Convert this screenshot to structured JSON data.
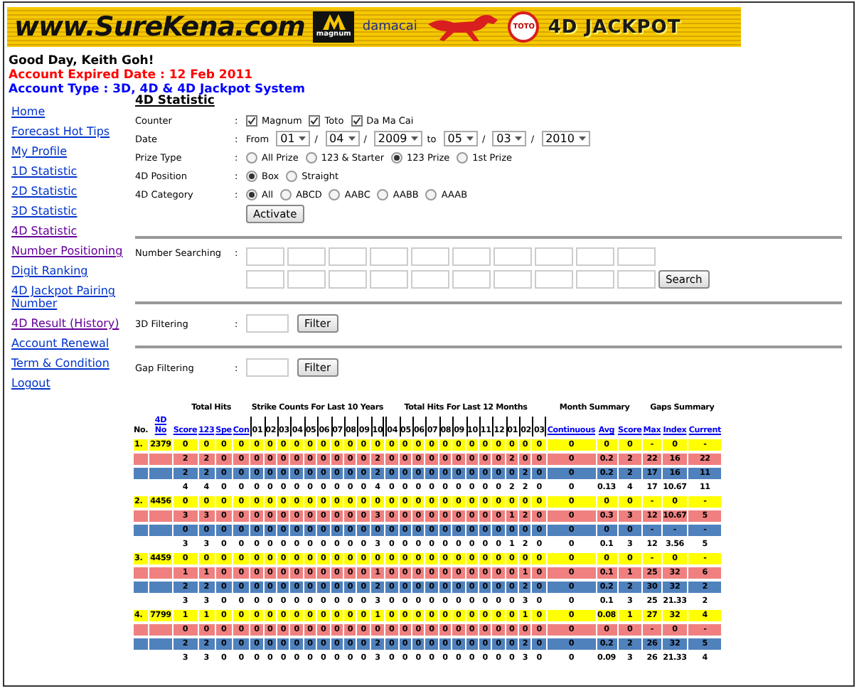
{
  "banner": {
    "site": "www.SureKena.com",
    "logos": [
      {
        "kind": "magnum",
        "text": "magnum"
      },
      {
        "kind": "damacai",
        "text": "damacai"
      },
      {
        "kind": "horse"
      },
      {
        "kind": "toto",
        "text": "TOTO"
      },
      {
        "kind": "jackpot",
        "text": "4D JACKPOT"
      }
    ]
  },
  "greeting": "Good Day, Keith Goh!",
  "expiry": "Account Expired Date : 12 Feb 2011",
  "account_type": "Account Type : 3D, 4D & 4D Jackpot System",
  "sidebar": {
    "items": [
      {
        "label": "Home",
        "visited": false
      },
      {
        "label": "Forecast Hot Tips",
        "visited": false
      },
      {
        "label": "My Profile",
        "visited": false
      },
      {
        "label": "1D Statistic",
        "visited": false
      },
      {
        "label": "2D Statistic",
        "visited": false
      },
      {
        "label": "3D Statistic",
        "visited": false
      },
      {
        "label": "4D Statistic",
        "visited": true
      },
      {
        "label": "Number Positioning",
        "visited": true
      },
      {
        "label": "Digit Ranking",
        "visited": false
      },
      {
        "label": "4D Jackpot Pairing Number",
        "visited": false
      },
      {
        "label": "4D Result (History)",
        "visited": true
      },
      {
        "label": "Account Renewal",
        "visited": false
      },
      {
        "label": "Term & Condition",
        "visited": false
      },
      {
        "label": "Logout",
        "visited": false
      }
    ]
  },
  "form": {
    "title": "4D Statistic",
    "rows": [
      {
        "kind": "checks",
        "label": "Counter",
        "colon": ":",
        "options": [
          {
            "label": "Magnum",
            "checked": true
          },
          {
            "label": "Toto",
            "checked": true
          },
          {
            "label": "Da Ma Cai",
            "checked": true
          }
        ]
      },
      {
        "kind": "date",
        "label": "Date",
        "colon": ":",
        "parts": [
          {
            "kind": "text",
            "value": "From"
          },
          {
            "kind": "select",
            "value": "01"
          },
          {
            "kind": "text",
            "value": "/"
          },
          {
            "kind": "select",
            "value": "04"
          },
          {
            "kind": "text",
            "value": "/"
          },
          {
            "kind": "select",
            "value": "2009"
          },
          {
            "kind": "text",
            "value": "to"
          },
          {
            "kind": "select",
            "value": "05"
          },
          {
            "kind": "text",
            "value": "/"
          },
          {
            "kind": "select",
            "value": "03"
          },
          {
            "kind": "text",
            "value": "/"
          },
          {
            "kind": "select",
            "value": "2010"
          }
        ]
      },
      {
        "kind": "radios",
        "label": "Prize Type",
        "colon": ":",
        "options": [
          {
            "label": "All Prize",
            "selected": false
          },
          {
            "label": "123 & Starter",
            "selected": false
          },
          {
            "label": "123 Prize",
            "selected": true
          },
          {
            "label": "1st Prize",
            "selected": false
          }
        ]
      },
      {
        "kind": "radios",
        "label": "4D Position",
        "colon": ":",
        "options": [
          {
            "label": "Box",
            "selected": true
          },
          {
            "label": "Straight",
            "selected": false
          }
        ]
      },
      {
        "kind": "radios",
        "label": "4D Category",
        "colon": ":",
        "options": [
          {
            "label": "All",
            "selected": true
          },
          {
            "label": "ABCD",
            "selected": false
          },
          {
            "label": "AABC",
            "selected": false
          },
          {
            "label": "AABB",
            "selected": false
          },
          {
            "label": "AAAB",
            "selected": false
          }
        ]
      }
    ],
    "activate": "Activate"
  },
  "searching": {
    "label": "Number Searching",
    "colon": ":",
    "button": "Search"
  },
  "filters": [
    {
      "label": "3D Filtering",
      "colon": ":",
      "button": "Filter"
    },
    {
      "label": "Gap Filtering",
      "colon": ":",
      "button": "Filter"
    }
  ],
  "table": {
    "sections": [
      {
        "link": false,
        "columns": [
          "No."
        ]
      },
      {
        "link": true,
        "columns": [
          "4D No"
        ]
      },
      {
        "title": "Total Hits",
        "link": true,
        "columns": [
          "Score",
          "123",
          "Spe",
          "Con"
        ]
      },
      {
        "title": "Strike Counts For Last 10 Years",
        "link": false,
        "columns": [
          "01",
          "02",
          "03",
          "04",
          "05",
          "06",
          "07",
          "08",
          "09",
          "10"
        ]
      },
      {
        "title": "Total Hits For Last 12 Months",
        "link": false,
        "columns": [
          "04",
          "05",
          "06",
          "07",
          "08",
          "09",
          "10",
          "11",
          "12",
          "01",
          "02",
          "03"
        ]
      },
      {
        "title": "Month Summary",
        "link": true,
        "columns": [
          "Continuous",
          "Avg",
          "Score"
        ]
      },
      {
        "title": "Gaps Summary",
        "link": true,
        "columns": [
          "Max",
          "Index",
          "Current"
        ]
      }
    ],
    "rows": [
      {
        "color": "#ffff00",
        "no": "1.",
        "number": "2379",
        "cells": [
          "0",
          "0",
          "0",
          "0",
          "0",
          "0",
          "0",
          "0",
          "0",
          "0",
          "0",
          "0",
          "0",
          "0",
          "0",
          "0",
          "0",
          "0",
          "0",
          "0",
          "0",
          "0",
          "0",
          "0",
          "0",
          "0",
          "0",
          "0",
          "0",
          "-",
          "0",
          "-"
        ]
      },
      {
        "color": "#f08080",
        "cells": [
          "2",
          "2",
          "0",
          "0",
          "0",
          "0",
          "0",
          "0",
          "0",
          "0",
          "0",
          "0",
          "0",
          "2",
          "0",
          "0",
          "0",
          "0",
          "0",
          "0",
          "0",
          "0",
          "0",
          "2",
          "0",
          "0",
          "0",
          "0.2",
          "2",
          "22",
          "16",
          "22"
        ]
      },
      {
        "color": "#4f81bd",
        "cells": [
          "2",
          "2",
          "0",
          "0",
          "0",
          "0",
          "0",
          "0",
          "0",
          "0",
          "0",
          "0",
          "0",
          "2",
          "0",
          "0",
          "0",
          "0",
          "0",
          "0",
          "0",
          "0",
          "0",
          "0",
          "2",
          "0",
          "0",
          "0.2",
          "2",
          "17",
          "16",
          "11"
        ]
      },
      {
        "color": "#ffffff",
        "cells": [
          "4",
          "4",
          "0",
          "0",
          "0",
          "0",
          "0",
          "0",
          "0",
          "0",
          "0",
          "0",
          "0",
          "4",
          "0",
          "0",
          "0",
          "0",
          "0",
          "0",
          "0",
          "0",
          "0",
          "2",
          "2",
          "0",
          "0",
          "0.13",
          "4",
          "17",
          "10.67",
          "11"
        ]
      },
      {
        "color": "#ffff00",
        "no": "2.",
        "number": "4456",
        "cells": [
          "0",
          "0",
          "0",
          "0",
          "0",
          "0",
          "0",
          "0",
          "0",
          "0",
          "0",
          "0",
          "0",
          "0",
          "0",
          "0",
          "0",
          "0",
          "0",
          "0",
          "0",
          "0",
          "0",
          "0",
          "0",
          "0",
          "0",
          "0",
          "0",
          "-",
          "0",
          "-"
        ]
      },
      {
        "color": "#f08080",
        "cells": [
          "3",
          "3",
          "0",
          "0",
          "0",
          "0",
          "0",
          "0",
          "0",
          "0",
          "0",
          "0",
          "0",
          "3",
          "0",
          "0",
          "0",
          "0",
          "0",
          "0",
          "0",
          "0",
          "0",
          "1",
          "2",
          "0",
          "0",
          "0.3",
          "3",
          "12",
          "10.67",
          "5"
        ]
      },
      {
        "color": "#4f81bd",
        "cells": [
          "0",
          "0",
          "0",
          "0",
          "0",
          "0",
          "0",
          "0",
          "0",
          "0",
          "0",
          "0",
          "0",
          "0",
          "0",
          "0",
          "0",
          "0",
          "0",
          "0",
          "0",
          "0",
          "0",
          "0",
          "0",
          "0",
          "0",
          "0",
          "0",
          "-",
          "-",
          "-"
        ]
      },
      {
        "color": "#ffffff",
        "cells": [
          "3",
          "3",
          "0",
          "0",
          "0",
          "0",
          "0",
          "0",
          "0",
          "0",
          "0",
          "0",
          "0",
          "3",
          "0",
          "0",
          "0",
          "0",
          "0",
          "0",
          "0",
          "0",
          "0",
          "1",
          "2",
          "0",
          "0",
          "0.1",
          "3",
          "12",
          "3.56",
          "5"
        ]
      },
      {
        "color": "#ffff00",
        "no": "3.",
        "number": "4459",
        "cells": [
          "0",
          "0",
          "0",
          "0",
          "0",
          "0",
          "0",
          "0",
          "0",
          "0",
          "0",
          "0",
          "0",
          "0",
          "0",
          "0",
          "0",
          "0",
          "0",
          "0",
          "0",
          "0",
          "0",
          "0",
          "0",
          "0",
          "0",
          "0",
          "0",
          "-",
          "0",
          "-"
        ]
      },
      {
        "color": "#f08080",
        "cells": [
          "1",
          "1",
          "0",
          "0",
          "0",
          "0",
          "0",
          "0",
          "0",
          "0",
          "0",
          "0",
          "0",
          "1",
          "0",
          "0",
          "0",
          "0",
          "0",
          "0",
          "0",
          "0",
          "0",
          "0",
          "1",
          "0",
          "0",
          "0.1",
          "1",
          "25",
          "32",
          "6"
        ]
      },
      {
        "color": "#4f81bd",
        "cells": [
          "2",
          "2",
          "0",
          "0",
          "0",
          "0",
          "0",
          "0",
          "0",
          "0",
          "0",
          "0",
          "0",
          "2",
          "0",
          "0",
          "0",
          "0",
          "0",
          "0",
          "0",
          "0",
          "0",
          "0",
          "2",
          "0",
          "0",
          "0.2",
          "2",
          "30",
          "32",
          "2"
        ]
      },
      {
        "color": "#ffffff",
        "cells": [
          "3",
          "3",
          "0",
          "0",
          "0",
          "0",
          "0",
          "0",
          "0",
          "0",
          "0",
          "0",
          "0",
          "3",
          "0",
          "0",
          "0",
          "0",
          "0",
          "0",
          "0",
          "0",
          "0",
          "0",
          "3",
          "0",
          "0",
          "0.1",
          "3",
          "25",
          "21.33",
          "2"
        ]
      },
      {
        "color": "#ffff00",
        "no": "4.",
        "number": "7799",
        "cells": [
          "1",
          "1",
          "0",
          "0",
          "0",
          "0",
          "0",
          "0",
          "0",
          "0",
          "0",
          "0",
          "0",
          "1",
          "0",
          "0",
          "0",
          "0",
          "0",
          "0",
          "0",
          "0",
          "0",
          "0",
          "1",
          "0",
          "0",
          "0.08",
          "1",
          "27",
          "32",
          "4"
        ]
      },
      {
        "color": "#f08080",
        "cells": [
          "0",
          "0",
          "0",
          "0",
          "0",
          "0",
          "0",
          "0",
          "0",
          "0",
          "0",
          "0",
          "0",
          "0",
          "0",
          "0",
          "0",
          "0",
          "0",
          "0",
          "0",
          "0",
          "0",
          "0",
          "0",
          "0",
          "0",
          "0",
          "0",
          "-",
          "0",
          "-"
        ]
      },
      {
        "color": "#4f81bd",
        "cells": [
          "2",
          "2",
          "0",
          "0",
          "0",
          "0",
          "0",
          "0",
          "0",
          "0",
          "0",
          "0",
          "0",
          "2",
          "0",
          "0",
          "0",
          "0",
          "0",
          "0",
          "0",
          "0",
          "0",
          "0",
          "2",
          "0",
          "0",
          "0.2",
          "2",
          "26",
          "32",
          "5"
        ]
      },
      {
        "color": "#ffffff",
        "cells": [
          "3",
          "3",
          "0",
          "0",
          "0",
          "0",
          "0",
          "0",
          "0",
          "0",
          "0",
          "0",
          "0",
          "3",
          "0",
          "0",
          "0",
          "0",
          "0",
          "0",
          "0",
          "0",
          "0",
          "0",
          "3",
          "0",
          "0",
          "0.09",
          "3",
          "26",
          "21.33",
          "4"
        ]
      }
    ]
  }
}
